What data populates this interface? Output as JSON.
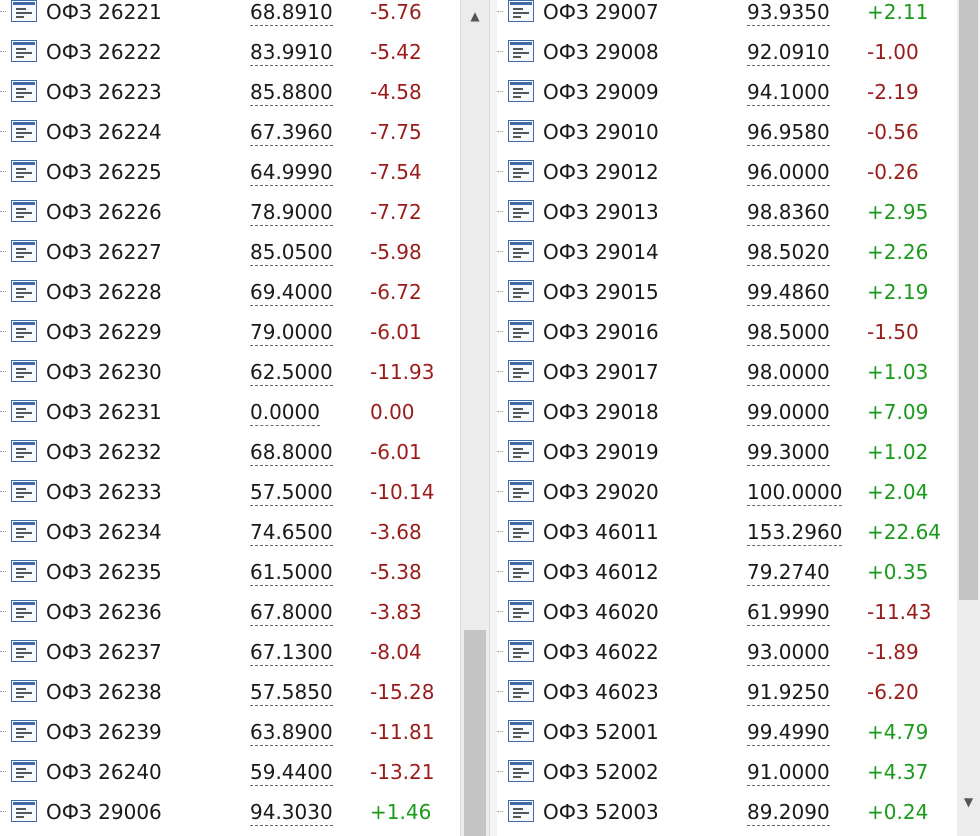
{
  "left": [
    {
      "name": "ОФЗ 26221",
      "price": "68.8910",
      "change": "-5.76",
      "dir": "neg"
    },
    {
      "name": "ОФЗ 26222",
      "price": "83.9910",
      "change": "-5.42",
      "dir": "neg"
    },
    {
      "name": "ОФЗ 26223",
      "price": "85.8800",
      "change": "-4.58",
      "dir": "neg"
    },
    {
      "name": "ОФЗ 26224",
      "price": "67.3960",
      "change": "-7.75",
      "dir": "neg"
    },
    {
      "name": "ОФЗ 26225",
      "price": "64.9990",
      "change": "-7.54",
      "dir": "neg"
    },
    {
      "name": "ОФЗ 26226",
      "price": "78.9000",
      "change": "-7.72",
      "dir": "neg"
    },
    {
      "name": "ОФЗ 26227",
      "price": "85.0500",
      "change": "-5.98",
      "dir": "neg"
    },
    {
      "name": "ОФЗ 26228",
      "price": "69.4000",
      "change": "-6.72",
      "dir": "neg"
    },
    {
      "name": "ОФЗ 26229",
      "price": "79.0000",
      "change": "-6.01",
      "dir": "neg"
    },
    {
      "name": "ОФЗ 26230",
      "price": "62.5000",
      "change": "-11.93",
      "dir": "neg"
    },
    {
      "name": "ОФЗ 26231",
      "price": "0.0000",
      "change": "0.00",
      "dir": "neg"
    },
    {
      "name": "ОФЗ 26232",
      "price": "68.8000",
      "change": "-6.01",
      "dir": "neg"
    },
    {
      "name": "ОФЗ 26233",
      "price": "57.5000",
      "change": "-10.14",
      "dir": "neg"
    },
    {
      "name": "ОФЗ 26234",
      "price": "74.6500",
      "change": "-3.68",
      "dir": "neg"
    },
    {
      "name": "ОФЗ 26235",
      "price": "61.5000",
      "change": "-5.38",
      "dir": "neg"
    },
    {
      "name": "ОФЗ 26236",
      "price": "67.8000",
      "change": "-3.83",
      "dir": "neg"
    },
    {
      "name": "ОФЗ 26237",
      "price": "67.1300",
      "change": "-8.04",
      "dir": "neg"
    },
    {
      "name": "ОФЗ 26238",
      "price": "57.5850",
      "change": "-15.28",
      "dir": "neg"
    },
    {
      "name": "ОФЗ 26239",
      "price": "63.8900",
      "change": "-11.81",
      "dir": "neg"
    },
    {
      "name": "ОФЗ 26240",
      "price": "59.4400",
      "change": "-13.21",
      "dir": "neg"
    },
    {
      "name": "ОФЗ 29006",
      "price": "94.3030",
      "change": "+1.46",
      "dir": "pos"
    }
  ],
  "right": [
    {
      "name": "ОФЗ 29007",
      "price": "93.9350",
      "change": "+2.11",
      "dir": "pos"
    },
    {
      "name": "ОФЗ 29008",
      "price": "92.0910",
      "change": "-1.00",
      "dir": "neg"
    },
    {
      "name": "ОФЗ 29009",
      "price": "94.1000",
      "change": "-2.19",
      "dir": "neg"
    },
    {
      "name": "ОФЗ 29010",
      "price": "96.9580",
      "change": "-0.56",
      "dir": "neg"
    },
    {
      "name": "ОФЗ 29012",
      "price": "96.0000",
      "change": "-0.26",
      "dir": "neg"
    },
    {
      "name": "ОФЗ 29013",
      "price": "98.8360",
      "change": "+2.95",
      "dir": "pos"
    },
    {
      "name": "ОФЗ 29014",
      "price": "98.5020",
      "change": "+2.26",
      "dir": "pos"
    },
    {
      "name": "ОФЗ 29015",
      "price": "99.4860",
      "change": "+2.19",
      "dir": "pos"
    },
    {
      "name": "ОФЗ 29016",
      "price": "98.5000",
      "change": "-1.50",
      "dir": "neg"
    },
    {
      "name": "ОФЗ 29017",
      "price": "98.0000",
      "change": "+1.03",
      "dir": "pos"
    },
    {
      "name": "ОФЗ 29018",
      "price": "99.0000",
      "change": "+7.09",
      "dir": "pos"
    },
    {
      "name": "ОФЗ 29019",
      "price": "99.3000",
      "change": "+1.02",
      "dir": "pos"
    },
    {
      "name": "ОФЗ 29020",
      "price": "100.0000",
      "change": "+2.04",
      "dir": "pos"
    },
    {
      "name": "ОФЗ 46011",
      "price": "153.2960",
      "change": "+22.64",
      "dir": "pos"
    },
    {
      "name": "ОФЗ 46012",
      "price": "79.2740",
      "change": "+0.35",
      "dir": "pos"
    },
    {
      "name": "ОФЗ 46020",
      "price": "61.9990",
      "change": "-11.43",
      "dir": "neg"
    },
    {
      "name": "ОФЗ 46022",
      "price": "93.0000",
      "change": "-1.89",
      "dir": "neg"
    },
    {
      "name": "ОФЗ 46023",
      "price": "91.9250",
      "change": "-6.20",
      "dir": "neg"
    },
    {
      "name": "ОФЗ 52001",
      "price": "99.4990",
      "change": "+4.79",
      "dir": "pos"
    },
    {
      "name": "ОФЗ 52002",
      "price": "91.0000",
      "change": "+4.37",
      "dir": "pos"
    },
    {
      "name": "ОФЗ 52003",
      "price": "89.2090",
      "change": "+0.24",
      "dir": "pos"
    }
  ],
  "colors": {
    "positive": "#1a9a1a",
    "negative": "#9b1b1b",
    "icon_border": "#3f6aa8"
  },
  "icons": {
    "row_icon": "document-list-icon",
    "scroll_up": "scroll-up-arrow-icon"
  },
  "scrollbars": {
    "left_position": "bottom",
    "right_position": "top"
  }
}
